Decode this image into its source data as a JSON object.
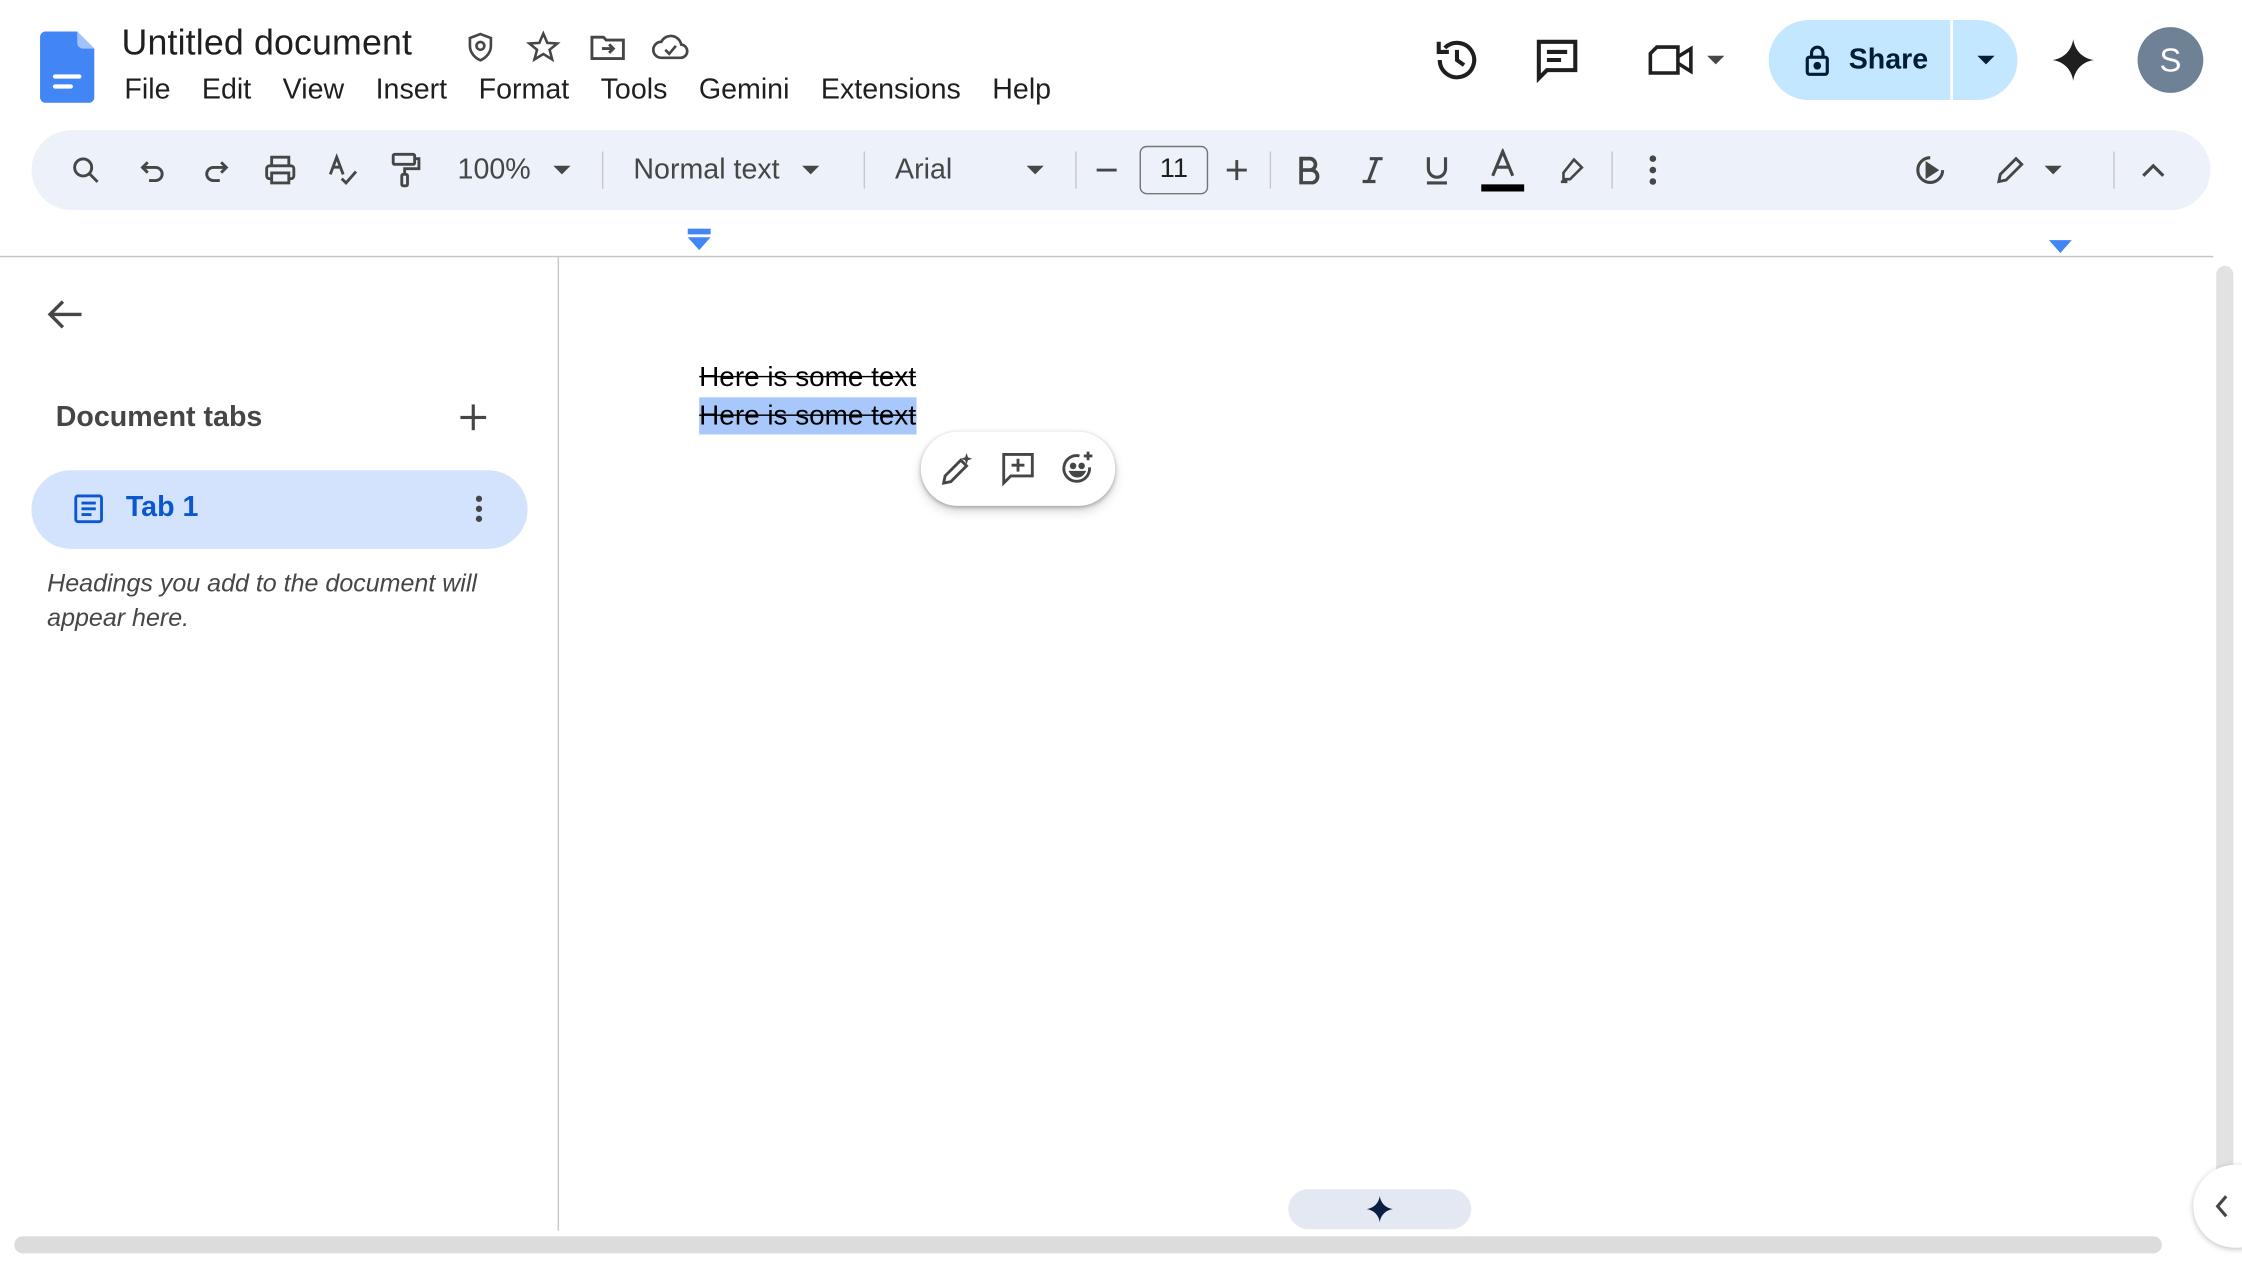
{
  "document": {
    "title": "Untitled document",
    "lines": [
      "Here is some text",
      "Here is some text"
    ]
  },
  "menu": [
    "File",
    "Edit",
    "View",
    "Insert",
    "Format",
    "Tools",
    "Gemini",
    "Extensions",
    "Help"
  ],
  "header": {
    "share_label": "Share",
    "avatar_initial": "S"
  },
  "toolbar": {
    "zoom": "100%",
    "style": "Normal text",
    "font": "Arial",
    "font_size": "11"
  },
  "sidebar": {
    "title": "Document tabs",
    "tabs": [
      {
        "label": "Tab 1",
        "selected": true
      }
    ],
    "hint": "Headings you add to the document will appear here."
  },
  "colors": {
    "accent": "#0b57d0",
    "share_bg": "#c2e7ff",
    "toolbar_bg": "#edf2fa",
    "selection": "#a8c7fa",
    "tab_selected_bg": "#d3e3fd"
  },
  "icons": [
    "docs-logo-icon",
    "security-icon",
    "star-icon",
    "move-folder-icon",
    "cloud-saved-icon",
    "version-history-icon",
    "comments-icon",
    "meet-icon",
    "lock-icon",
    "gemini-icon",
    "search-icon",
    "undo-icon",
    "redo-icon",
    "print-icon",
    "spellcheck-icon",
    "paint-format-icon",
    "bold-icon",
    "italic-icon",
    "underline-icon",
    "text-color-icon",
    "highlight-icon",
    "more-vert-icon",
    "edit-mode-icon",
    "collapse-icon",
    "back-arrow-icon",
    "add-icon",
    "document-icon",
    "emoji-icon",
    "add-comment-icon",
    "help-me-write-icon"
  ]
}
